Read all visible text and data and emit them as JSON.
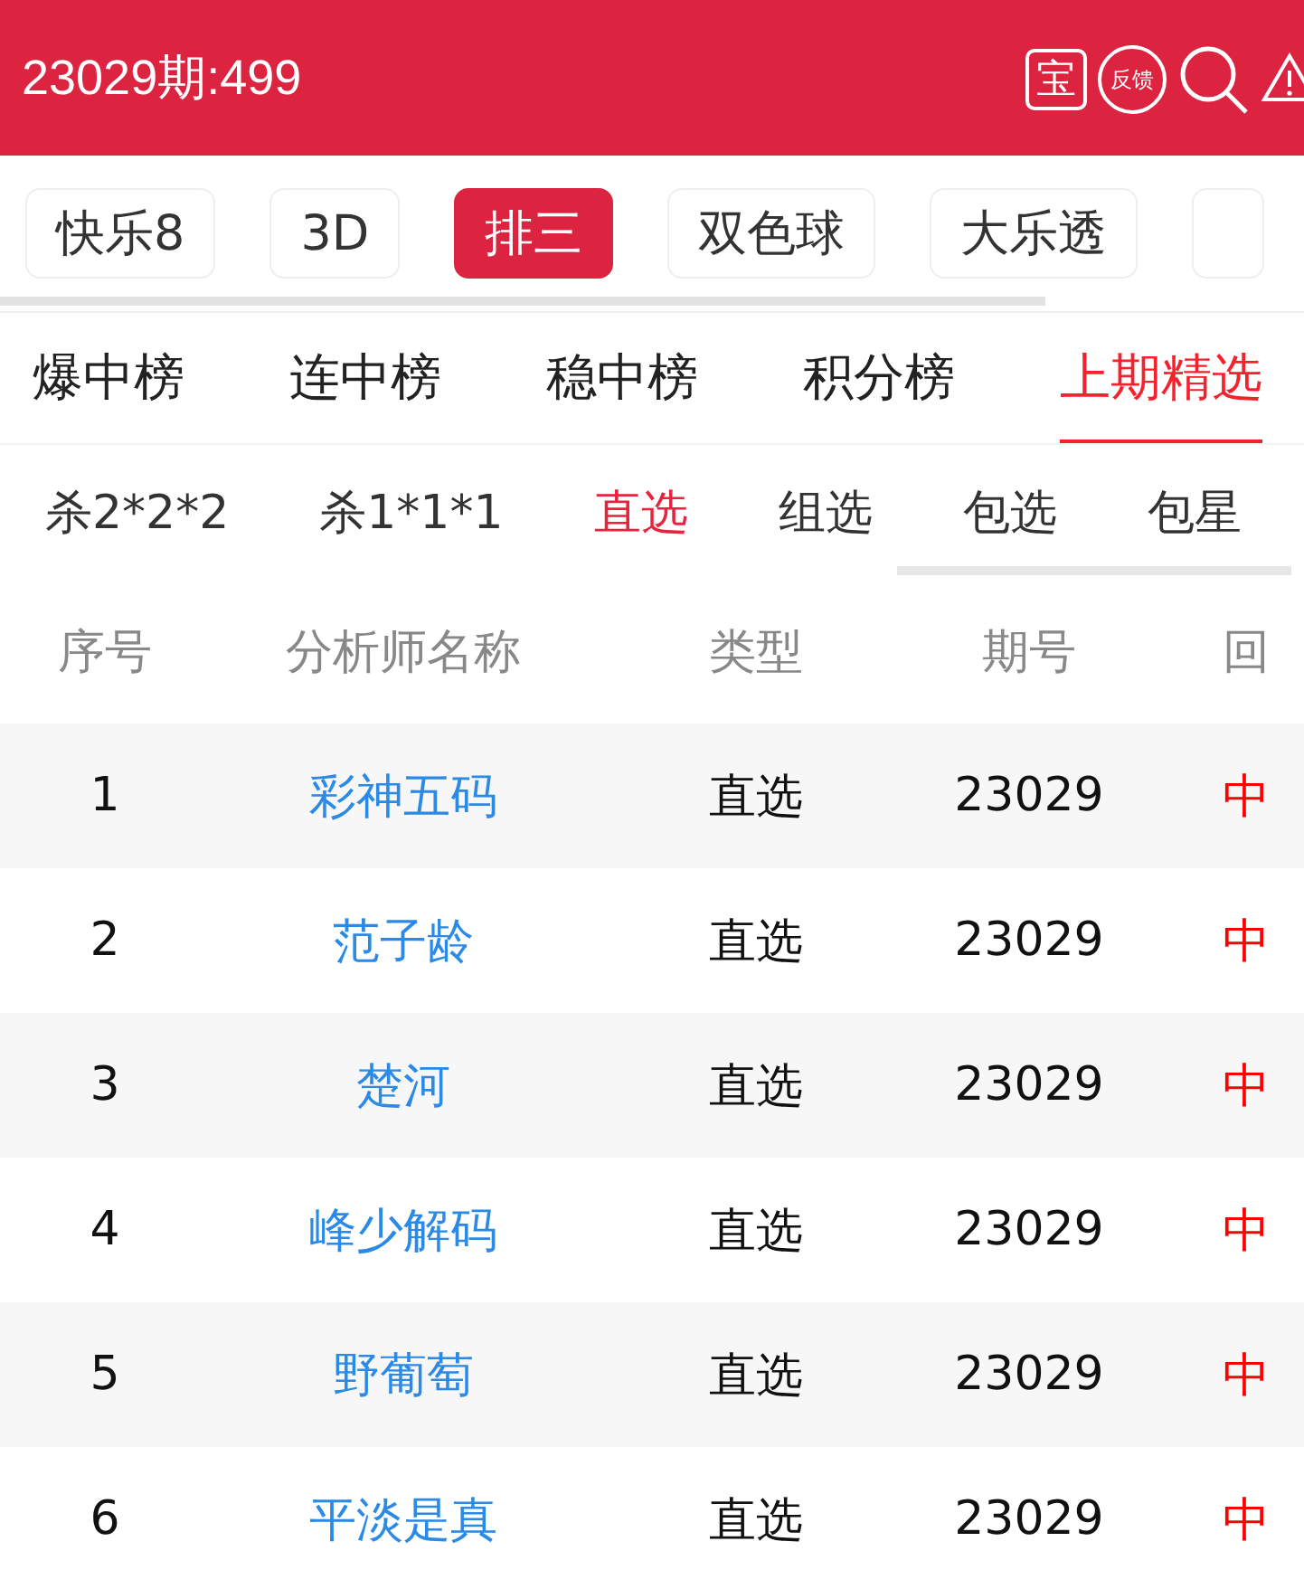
{
  "header": {
    "title": "23029期:499",
    "treasure_label": "宝",
    "feedback_label": "反馈"
  },
  "lottery_tabs": [
    {
      "label": "快乐8",
      "selected": false
    },
    {
      "label": "3D",
      "selected": false
    },
    {
      "label": "排三",
      "selected": true
    },
    {
      "label": "双色球",
      "selected": false
    },
    {
      "label": "大乐透",
      "selected": false
    }
  ],
  "rank_tabs": [
    {
      "label": "爆中榜",
      "selected": false
    },
    {
      "label": "连中榜",
      "selected": false
    },
    {
      "label": "稳中榜",
      "selected": false
    },
    {
      "label": "积分榜",
      "selected": false
    },
    {
      "label": "上期精选",
      "selected": true
    }
  ],
  "play_tabs": [
    {
      "label": "杀2*2*2",
      "selected": false
    },
    {
      "label": "杀1*1*1",
      "selected": false
    },
    {
      "label": "直选",
      "selected": true
    },
    {
      "label": "组选",
      "selected": false
    },
    {
      "label": "包选",
      "selected": false
    },
    {
      "label": "包星",
      "selected": false
    }
  ],
  "table": {
    "columns": [
      "序号",
      "分析师名称",
      "类型",
      "期号",
      "回"
    ],
    "rows": [
      {
        "index": "1",
        "analyst": "彩神五码",
        "type": "直选",
        "issue": "23029",
        "result": "中"
      },
      {
        "index": "2",
        "analyst": "范子龄",
        "type": "直选",
        "issue": "23029",
        "result": "中"
      },
      {
        "index": "3",
        "analyst": "楚河",
        "type": "直选",
        "issue": "23029",
        "result": "中"
      },
      {
        "index": "4",
        "analyst": "峰少解码",
        "type": "直选",
        "issue": "23029",
        "result": "中"
      },
      {
        "index": "5",
        "analyst": "野葡萄",
        "type": "直选",
        "issue": "23029",
        "result": "中"
      },
      {
        "index": "6",
        "analyst": "平淡是真",
        "type": "直选",
        "issue": "23029",
        "result": "中"
      }
    ]
  }
}
